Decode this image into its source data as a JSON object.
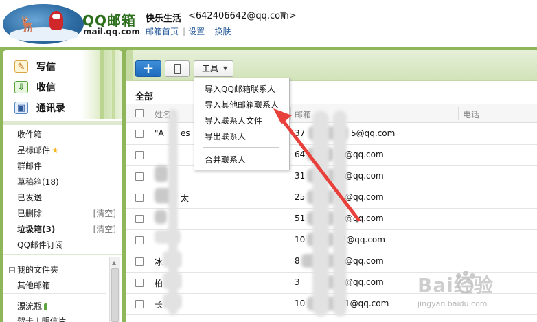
{
  "header": {
    "logo_brand": "QQ邮箱",
    "logo_url": "mail.qq.com",
    "user_name": "快乐生活",
    "user_email": "<642406642@qq.com>",
    "links": [
      "邮箱首页",
      "设置",
      "换肤"
    ],
    "link_sep": "|",
    "link_sep2": "-"
  },
  "sidebar": {
    "actions": {
      "write": "写信",
      "inbox": "收信",
      "contacts": "通讯录"
    },
    "folders": {
      "inbox": "收件箱",
      "starred": "星标邮件",
      "group": "群邮件",
      "drafts": "草稿箱(18)",
      "sent": "已发送",
      "deleted": "已删除",
      "deleted_action": "[清空]",
      "junk": "垃圾箱(3)",
      "junk_action": "[清空]",
      "subscribe": "QQ邮件订阅"
    },
    "my_folders": "我的文件夹",
    "other_mailbox": "其他邮箱",
    "drift_bottle": "漂流瓶",
    "cards": "贺卡 | 明信片"
  },
  "toolbar": {
    "add_label": "+",
    "tools_label": "工具",
    "tools_caret": "▼"
  },
  "main": {
    "section_title": "全部",
    "columns": {
      "name": "姓名↓",
      "email": "邮箱",
      "phone": "电话"
    },
    "rows": [
      {
        "name": "\"A",
        "name2": "es",
        "email": "37",
        "email2": "5@qq.com"
      },
      {
        "name": "",
        "name2": "",
        "email": "64",
        "email2": "09",
        "email3": "@qq.com"
      },
      {
        "name": "",
        "name2": "",
        "email": "31",
        "email2": "@qq.com"
      },
      {
        "name": "",
        "name2": "太",
        "email": "25",
        "email2": "9",
        "email3": "@qq.com"
      },
      {
        "name": "",
        "name2": "",
        "email": "51",
        "email2": "9",
        "email3": "@qq.com"
      },
      {
        "name": "",
        "name2": "",
        "email": "10",
        "email2": "87@qq.com"
      },
      {
        "name": "冰",
        "name2": "",
        "email": "8",
        "email2": "@qq.com"
      },
      {
        "name": "柏",
        "name2": "",
        "email": "3",
        "email2": "70",
        "email3": "@qq.com"
      },
      {
        "name": "长",
        "name2": "",
        "email": "10",
        "email2": "1@qq.com"
      }
    ]
  },
  "tools_menu": {
    "items": [
      "导入QQ邮箱联系人",
      "导入其他邮箱联系人",
      "导入联系人文件",
      "导出联系人",
      "合并联系人"
    ]
  },
  "watermark": {
    "text": "Bai经验",
    "url": "jingyan.baidu.com"
  },
  "colors": {
    "frame_green": "#8fb659",
    "accent_blue": "#1e6bbd",
    "arrow_red": "#e8413b",
    "link_blue": "#2a5d9c"
  }
}
